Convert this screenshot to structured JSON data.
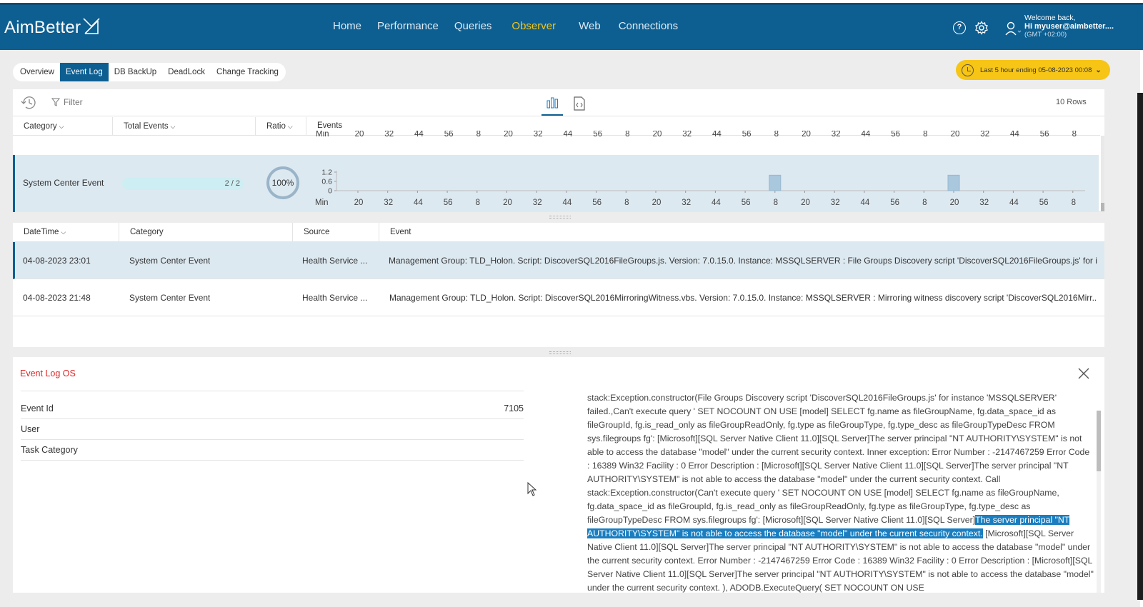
{
  "header": {
    "logo": "AimBetter",
    "nav": [
      "Home",
      "Performance",
      "Queries",
      "Observer",
      "Web",
      "Connections"
    ],
    "active_nav": "Observer",
    "welcome": "Welcome back,",
    "user": "Hi myuser@aimbetter....",
    "timezone": "(GMT +02:00)"
  },
  "subtabs": [
    "Overview",
    "Event Log",
    "DB BackUp",
    "DeadLock",
    "Change Tracking"
  ],
  "active_subtab": "Event Log",
  "time_range": "Last 5 hour ending  05-08-2023 00:08",
  "toolbar": {
    "filter": "Filter",
    "rows": "10 Rows"
  },
  "columns": {
    "category": "Category",
    "total_events": "Total Events",
    "ratio": "Ratio",
    "events": "Events"
  },
  "chart_data": {
    "type": "bar",
    "row_label": "System Center Event",
    "total": "2 / 2",
    "ratio": "100%",
    "y_ticks": [
      "1.2",
      "0.6",
      "0"
    ],
    "x_label": "Min",
    "x_ticks": [
      "20",
      "32",
      "44",
      "56",
      "8",
      "20",
      "32",
      "44",
      "56",
      "8",
      "20",
      "32",
      "44",
      "56",
      "8",
      "20",
      "32",
      "44",
      "56",
      "8",
      "20",
      "32",
      "44",
      "56",
      "8"
    ],
    "ylim": [
      0,
      1.2
    ],
    "bars": [
      {
        "tick_index": 14,
        "value": 1
      },
      {
        "tick_index": 20,
        "value": 1
      }
    ]
  },
  "table": {
    "headers": [
      "DateTime",
      "Category",
      "Source",
      "Event"
    ],
    "rows": [
      {
        "datetime": "04-08-2023 23:01",
        "category": "System Center Event",
        "source": "Health Service ...",
        "event": "Management Group: TLD_Holon. Script: DiscoverSQL2016FileGroups.js. Version: 7.0.15.0. Instance: MSSQLSERVER : File Groups Discovery script 'DiscoverSQL2016FileGroups.js' for i..."
      },
      {
        "datetime": "04-08-2023 21:48",
        "category": "System Center Event",
        "source": "Health Service ...",
        "event": "Management Group: TLD_Holon. Script: DiscoverSQL2016MirroringWitness.vbs. Version: 7.0.15.0. Instance: MSSQLSERVER : Mirroring witness discovery script 'DiscoverSQL2016Mirr..."
      }
    ]
  },
  "detail": {
    "title": "Event Log OS",
    "fields": [
      {
        "key": "Event Id",
        "value": "7105"
      },
      {
        "key": "User",
        "value": ""
      },
      {
        "key": "Task Category",
        "value": ""
      }
    ],
    "text_before": "stack:Exception.constructor(File Groups Discovery script 'DiscoverSQL2016FileGroups.js' for instance 'MSSQLSERVER' failed.,Can't execute query ' SET NOCOUNT ON USE [model] SELECT fg.name as fileGroupName, fg.data_space_id as fileGroupId, fg.is_read_only as fileGroupReadOnly, fg.type as fileGroupType, fg.type_desc as fileGroupTypeDesc FROM sys.filegroups fg': [Microsoft][SQL Server Native Client 11.0][SQL Server]The server principal \"NT AUTHORITY\\SYSTEM\" is not able to access the database \"model\" under the current security context. Inner exception: Error Number : -2147467259 Error Code : 16389 Win32 Facility : 0 Error Description : [Microsoft][SQL Server Native Client 11.0][SQL Server]The server principal \"NT AUTHORITY\\SYSTEM\" is not able to access the database \"model\" under the current security context. Call stack:Exception.constructor(Can't execute query ' SET NOCOUNT ON USE [model] SELECT fg.name as fileGroupName, fg.data_space_id as fileGroupId, fg.is_read_only as fileGroupReadOnly, fg.type as fileGroupType, fg.type_desc as fileGroupTypeDesc FROM sys.filegroups fg': [Microsoft][SQL Server Native Client 11.0][SQL Server]",
    "text_highlight": "The server principal \"NT AUTHORITY\\SYSTEM\" is not able to access the database \"model\" under the current security context.",
    "text_after": " [Microsoft][SQL Server Native Client 11.0][SQL Server]The server principal \"NT AUTHORITY\\SYSTEM\" is not able to access the database \"model\" under the current security context. Error Number : -2147467259 Error Code : 16389 Win32 Facility : 0 Error Description : [Microsoft][SQL Server Native Client 11.0][SQL Server]The server principal \"NT AUTHORITY\\SYSTEM\" is not able to access the database \"model\" under the current security context. ), ADODB.ExecuteQuery( SET NOCOUNT ON USE"
  },
  "colors": {
    "header": "#0d5f92",
    "accent": "#f6c515",
    "selection": "#dde9f1",
    "highlight": "#1a7ec0",
    "title_red": "#e02424"
  },
  "icons": [
    "help-icon",
    "gear-icon",
    "user-icon",
    "history-icon",
    "filter-icon",
    "bar-chart-icon",
    "code-file-icon",
    "clock-icon",
    "close-icon"
  ]
}
